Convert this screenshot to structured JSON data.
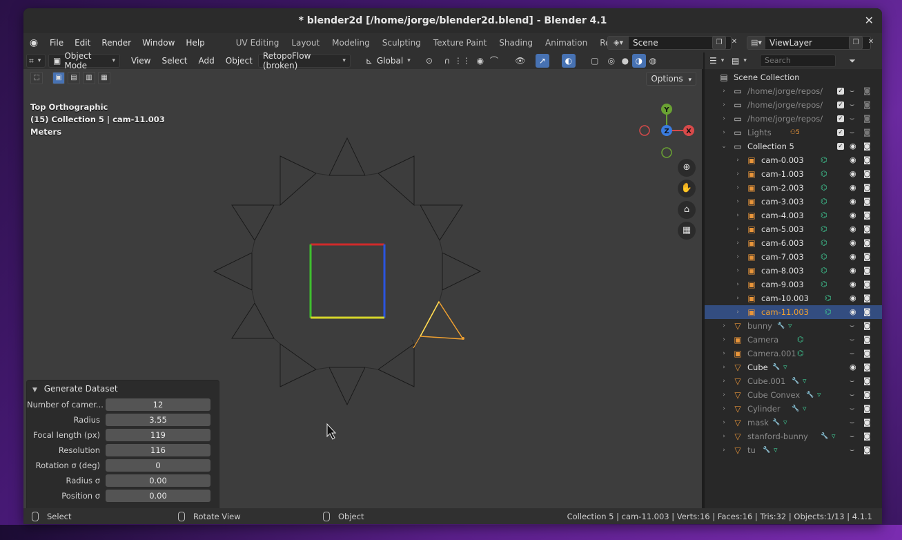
{
  "window": {
    "title": "* blender2d [/home/jorge/blender2d.blend] - Blender 4.1"
  },
  "menu": [
    "File",
    "Edit",
    "Render",
    "Window",
    "Help"
  ],
  "workspaces": [
    "UV Editing",
    "Layout",
    "Modeling",
    "Sculpting",
    "Texture Paint",
    "Shading",
    "Animation",
    "Rendering"
  ],
  "scene": "Scene",
  "view_layer": "ViewLayer",
  "viewport": {
    "mode": "Object Mode",
    "menus": [
      "View",
      "Select",
      "Add",
      "Object"
    ],
    "addon_menu": "RetopoFlow (broken)",
    "transform_orientation": "Global",
    "options": "Options",
    "info_view": "Top Orthographic",
    "info_collection": "(15) Collection 5 | cam-11.003",
    "info_units": "Meters",
    "gizmo_axes": {
      "x": "X",
      "y": "Y",
      "z": "Z"
    }
  },
  "redo_panel": {
    "title": "Generate Dataset",
    "fields": [
      {
        "label": "Number of camer...",
        "value": "12"
      },
      {
        "label": "Radius",
        "value": "3.55"
      },
      {
        "label": "Focal length (px)",
        "value": "119"
      },
      {
        "label": "Resolution",
        "value": "116"
      },
      {
        "label": "Rotation σ (deg)",
        "value": "0"
      },
      {
        "label": "Radius σ",
        "value": "0.00"
      },
      {
        "label": "Position σ",
        "value": "0.00"
      }
    ]
  },
  "outliner": {
    "search_placeholder": "Search",
    "root": "Scene Collection",
    "rows": [
      {
        "name": "/home/jorge/repos/NeR",
        "kind": "collection",
        "dim": true
      },
      {
        "name": "/home/jorge/repos/NeR",
        "kind": "collection",
        "dim": true
      },
      {
        "name": "/home/jorge/repos/NeR",
        "kind": "collection",
        "dim": true
      },
      {
        "name": "Lights",
        "kind": "collection",
        "dim": true,
        "badge": "5"
      },
      {
        "name": "Collection 5",
        "kind": "collection",
        "expanded": true
      },
      {
        "name": "cam-0.003",
        "kind": "camera",
        "child": true
      },
      {
        "name": "cam-1.003",
        "kind": "camera",
        "child": true
      },
      {
        "name": "cam-2.003",
        "kind": "camera",
        "child": true
      },
      {
        "name": "cam-3.003",
        "kind": "camera",
        "child": true
      },
      {
        "name": "cam-4.003",
        "kind": "camera",
        "child": true
      },
      {
        "name": "cam-5.003",
        "kind": "camera",
        "child": true
      },
      {
        "name": "cam-6.003",
        "kind": "camera",
        "child": true
      },
      {
        "name": "cam-7.003",
        "kind": "camera",
        "child": true
      },
      {
        "name": "cam-8.003",
        "kind": "camera",
        "child": true
      },
      {
        "name": "cam-9.003",
        "kind": "camera",
        "child": true
      },
      {
        "name": "cam-10.003",
        "kind": "camera",
        "child": true
      },
      {
        "name": "cam-11.003",
        "kind": "camera",
        "child": true,
        "selected": true
      },
      {
        "name": "bunny",
        "kind": "mesh",
        "dim": true
      },
      {
        "name": "Camera",
        "kind": "camera",
        "dim": true
      },
      {
        "name": "Camera.001",
        "kind": "camera",
        "dim": true
      },
      {
        "name": "Cube",
        "kind": "mesh",
        "visible": true
      },
      {
        "name": "Cube.001",
        "kind": "mesh",
        "dim": true
      },
      {
        "name": "Cube Convex",
        "kind": "mesh",
        "dim": true
      },
      {
        "name": "Cylinder",
        "kind": "mesh",
        "dim": true
      },
      {
        "name": "mask",
        "kind": "mesh",
        "dim": true
      },
      {
        "name": "stanford-bunny",
        "kind": "mesh",
        "dim": true
      },
      {
        "name": "tu",
        "kind": "mesh",
        "dim": true
      }
    ]
  },
  "statusbar": {
    "left": "Select",
    "middle": "Rotate View",
    "right": "Object",
    "stats": "Collection 5 | cam-11.003 | Verts:16 | Faces:16 | Tris:32 | Objects:1/13 | 4.1.1"
  }
}
